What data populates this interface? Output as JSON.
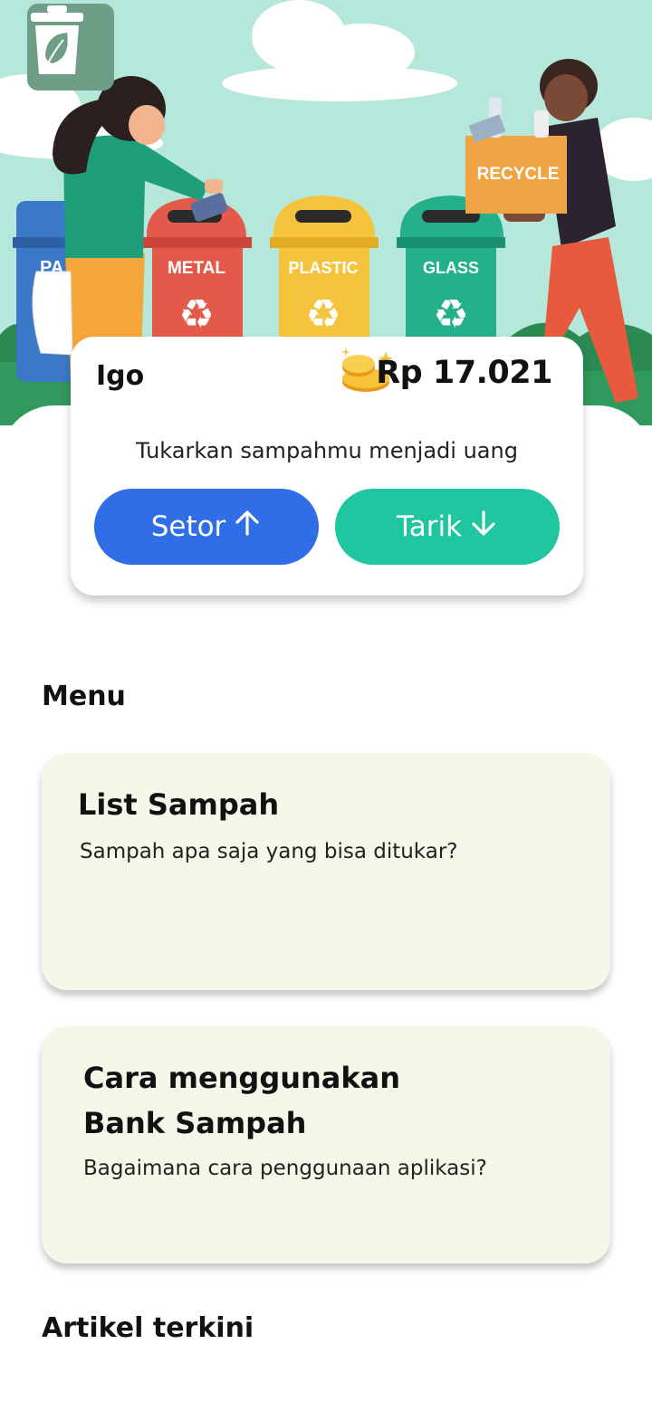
{
  "hero": {
    "bin_labels": [
      "PA",
      "METAL",
      "PLASTIC",
      "GLASS"
    ],
    "box_label": "RECYCLE",
    "colors": {
      "sky": "#b5e8da",
      "blue_bin": "#3c78c8",
      "red_bin": "#e45a4a",
      "yellow_bin": "#f6c43c",
      "green_bin": "#23b08a"
    }
  },
  "balance_card": {
    "user_name": "Igo",
    "balance": "Rp 17.021",
    "tagline": "Tukarkan sampahmu menjadi uang",
    "deposit_label": "Setor",
    "withdraw_label": "Tarik"
  },
  "menu": {
    "title": "Menu",
    "items": [
      {
        "title": "List Sampah",
        "description": "Sampah apa saja yang bisa ditukar?"
      },
      {
        "title_line1": "Cara menggunakan",
        "title_line2": "Bank Sampah",
        "description": "Bagaimana cara penggunaan aplikasi?"
      }
    ]
  },
  "articles": {
    "title": "Artikel terkini"
  },
  "colors": {
    "deposit": "#2f6ee6",
    "withdraw": "#1fc6a0",
    "menu_card_bg": "#f4f8e8"
  }
}
